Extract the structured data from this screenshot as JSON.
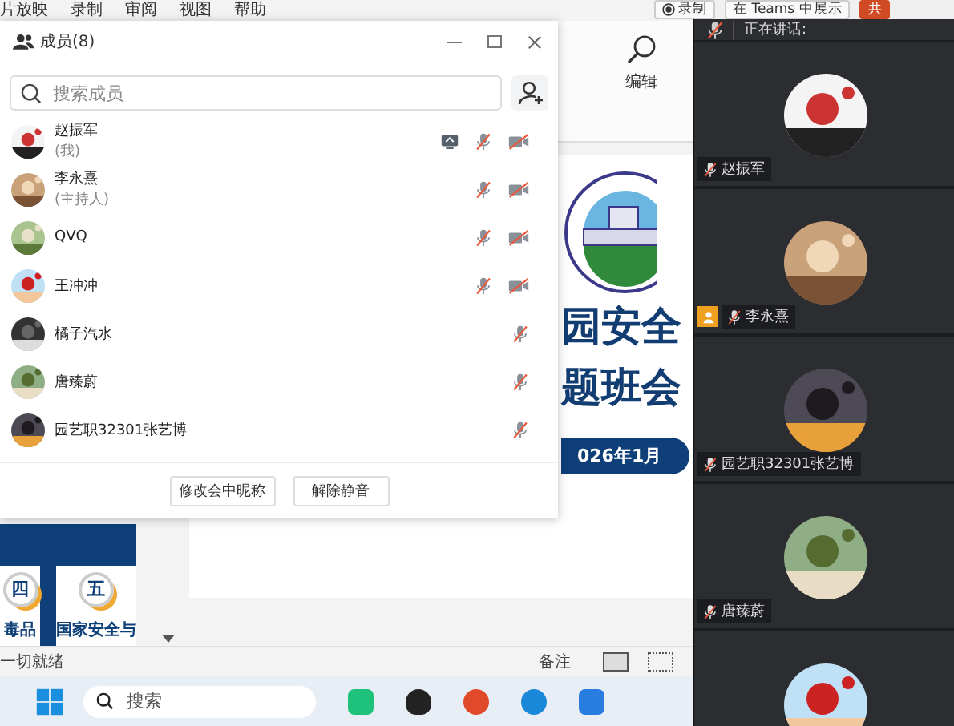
{
  "ppt": {
    "menu": [
      "片放映",
      "录制",
      "审阅",
      "视图",
      "帮助"
    ],
    "top_buttons": [
      {
        "label": "录制",
        "kind": "record"
      },
      {
        "label": "在 Teams 中展示",
        "kind": "teams"
      },
      {
        "label": "共",
        "kind": "share"
      }
    ],
    "ribbon": {
      "edit_label": "编辑"
    },
    "slide": {
      "title_lines": [
        "园安全",
        "题班会"
      ],
      "date": "026年1月"
    },
    "thumbnails": [
      {
        "number": "四",
        "caption": "毒品"
      },
      {
        "number": "五",
        "caption": "国家安全与"
      }
    ],
    "status": "一切就绪",
    "notes": "备注"
  },
  "members": {
    "title": "成员(8)",
    "search": {
      "placeholder": "搜索成员"
    },
    "list": [
      {
        "name": "赵振军",
        "role": "(我)",
        "sharing": true,
        "mic_muted": true,
        "camera_off": true
      },
      {
        "name": "李永熹",
        "role": "(主持人)",
        "sharing": false,
        "mic_muted": true,
        "camera_off": true
      },
      {
        "name": "QVQ",
        "sharing": false,
        "mic_muted": true,
        "camera_off": true
      },
      {
        "name": "王冲冲",
        "sharing": false,
        "mic_muted": true,
        "camera_off": true
      },
      {
        "name": "橘子汽水",
        "sharing": false,
        "mic_muted": true,
        "camera_off": false
      },
      {
        "name": "唐臻蔚",
        "sharing": false,
        "mic_muted": true,
        "camera_off": false
      },
      {
        "name": "园艺职32301张艺博",
        "sharing": false,
        "mic_muted": true,
        "camera_off": false
      }
    ],
    "buttons": [
      "修改会中昵称",
      "解除静音"
    ]
  },
  "video_panel": {
    "speaking_label": "正在讲话:",
    "tiles": [
      {
        "name": "赵振军",
        "host": false
      },
      {
        "name": "李永熹",
        "host": true
      },
      {
        "name": "园艺职32301张艺博",
        "host": false
      },
      {
        "name": "唐臻蔚",
        "host": false
      },
      {
        "host": false
      }
    ]
  },
  "taskbar": {
    "search": {
      "placeholder": "搜索"
    }
  }
}
